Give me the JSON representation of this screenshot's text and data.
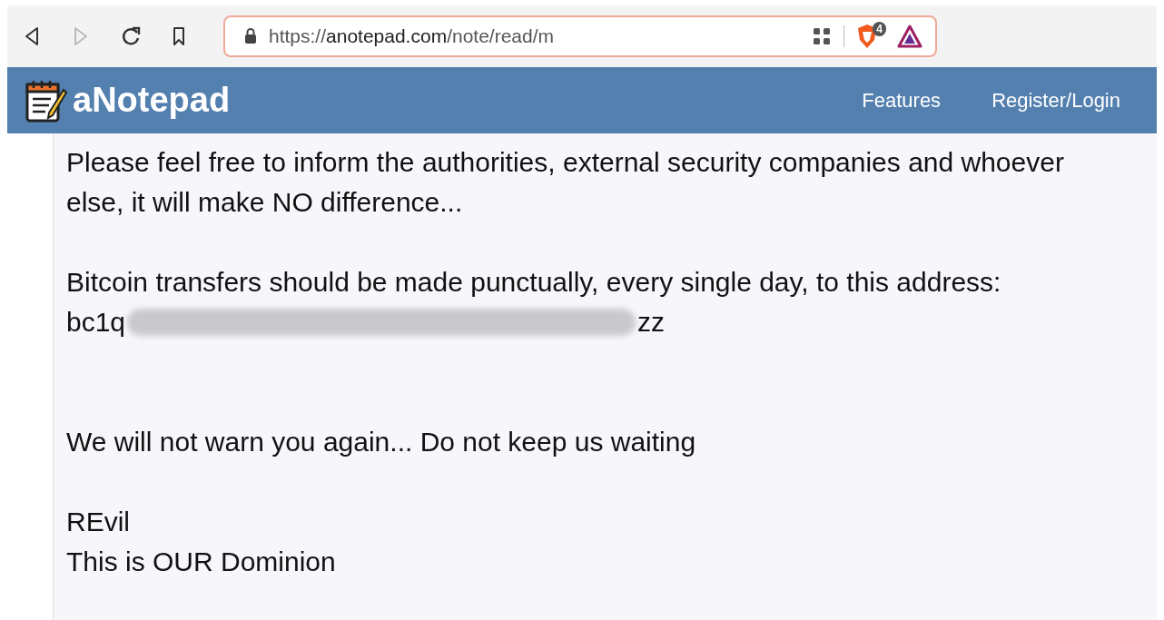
{
  "browser": {
    "back_disabled": false,
    "forward_disabled": true,
    "url_scheme": "https://",
    "url_host": "anotepad.com",
    "url_path": "/note/read/m",
    "shield_count": "4"
  },
  "site_header": {
    "logo": "aNotepad",
    "nav": [
      "Features",
      "Register/Login"
    ]
  },
  "note": {
    "paragraphs": [
      {
        "kind": "text",
        "lines": [
          "Please feel free to inform the authorities, external security companies and whoever else, it will make NO difference..."
        ]
      },
      {
        "kind": "payment",
        "lines": [
          "Bitcoin transfers should be made punctually, every single day, to this address:"
        ],
        "address_start": "bc1q",
        "address_end": "zz"
      },
      {
        "kind": "text",
        "lines": [
          "We will not warn you again... Do not keep us waiting"
        ]
      },
      {
        "kind": "text",
        "lines": [
          "REvil",
          "This is OUR Dominion"
        ]
      }
    ]
  }
}
